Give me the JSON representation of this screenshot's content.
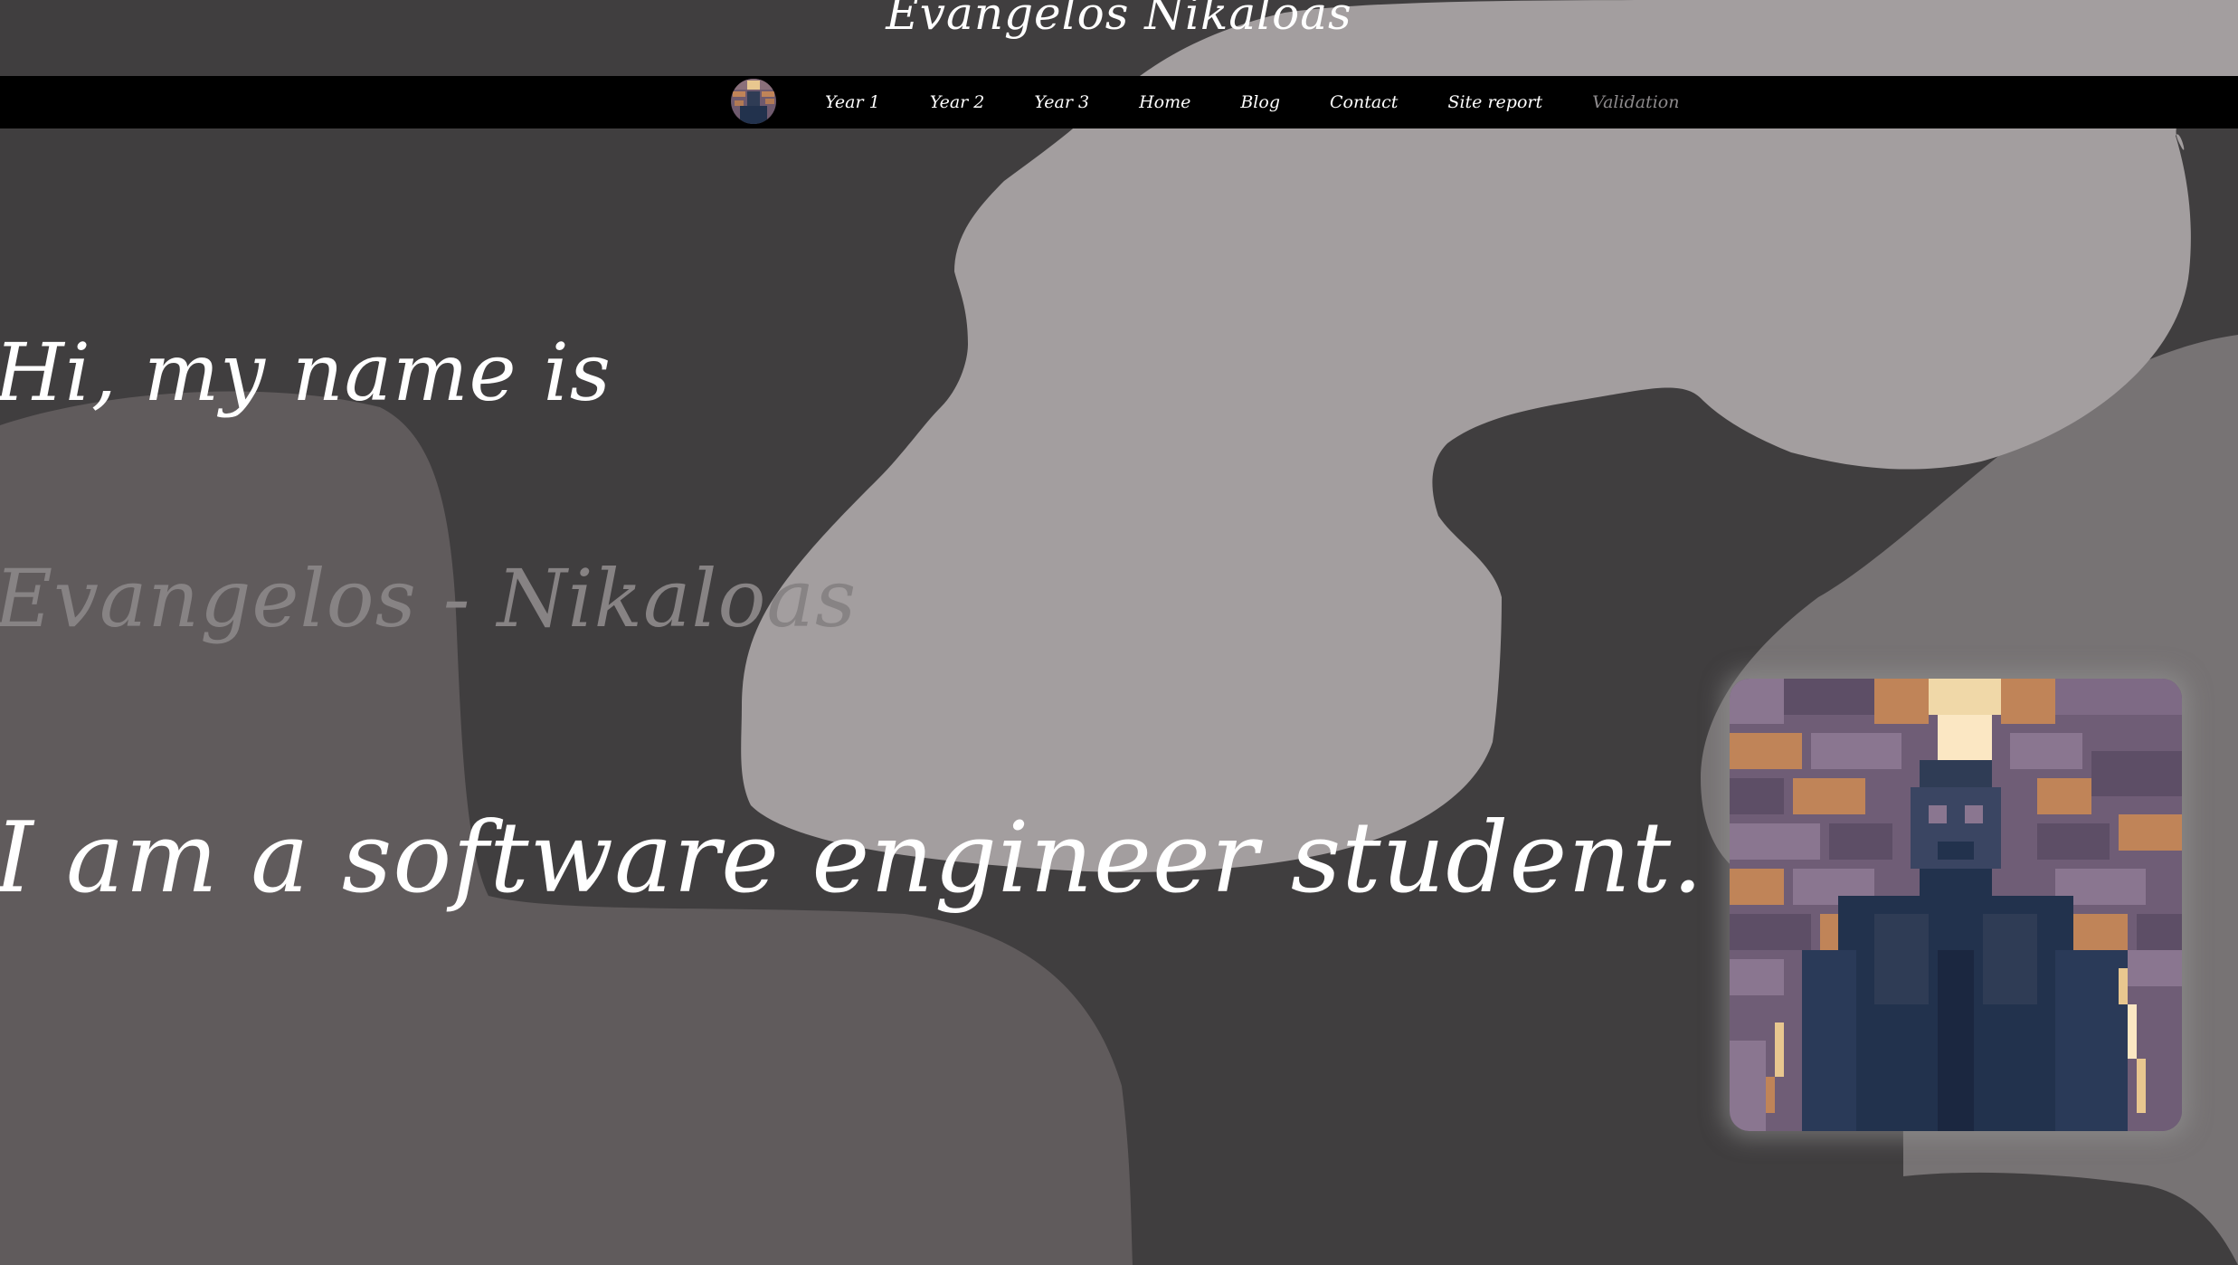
{
  "site": {
    "title": "Evangelos Nikaloas"
  },
  "nav": {
    "avatar_alt": "profile-avatar",
    "items": [
      {
        "label": "Year 1"
      },
      {
        "label": "Year 2"
      },
      {
        "label": "Year 3"
      },
      {
        "label": "Home"
      },
      {
        "label": "Blog"
      },
      {
        "label": "Contact"
      },
      {
        "label": "Site report"
      },
      {
        "label": "Validation"
      }
    ]
  },
  "hero": {
    "greeting": "Hi, my name is",
    "name": "Evangelos - Nikaloas",
    "tagline": "I am a software engineer student."
  },
  "colors": {
    "background": "#403e3f",
    "blob_light": "#a39e9f",
    "blob_mid": "#605b5c",
    "blob_mid2": "#777374",
    "navbar": "#000000",
    "text": "#ffffff",
    "text_dim": "#878384"
  },
  "portrait": {
    "name": "pixelated-portrait-photo"
  }
}
